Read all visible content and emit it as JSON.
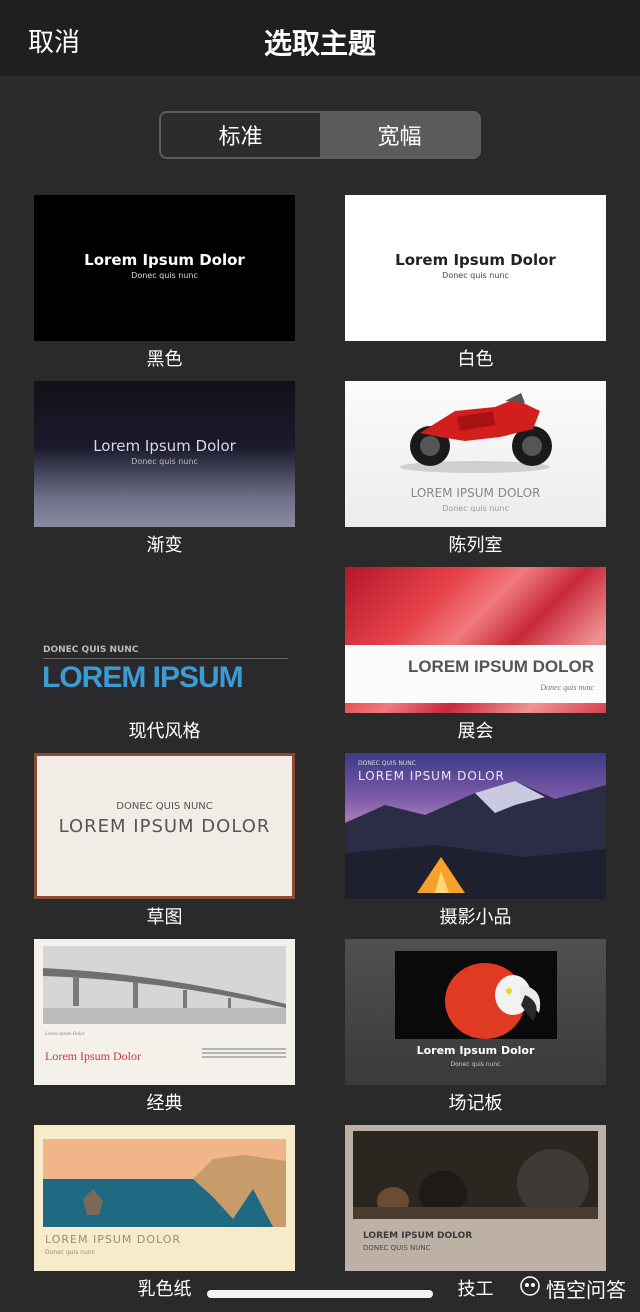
{
  "header": {
    "cancel_label": "取消",
    "title": "选取主题"
  },
  "segments": [
    {
      "label": "标准",
      "selected": true
    },
    {
      "label": "宽幅",
      "selected": false
    }
  ],
  "themes": [
    {
      "name": "黑色",
      "title": "Lorem Ipsum Dolor",
      "subtitle": "Donec quis nunc"
    },
    {
      "name": "白色",
      "title": "Lorem Ipsum Dolor",
      "subtitle": "Donec quis nunc"
    },
    {
      "name": "渐变",
      "title": "Lorem Ipsum Dolor",
      "subtitle": "Donec quis nunc"
    },
    {
      "name": "陈列室",
      "title": "LOREM IPSUM DOLOR",
      "subtitle": "Donec quis nunc"
    },
    {
      "name": "现代风格",
      "title": "LOREM IPSUM",
      "subtitle": "DONEC QUIS NUNC"
    },
    {
      "name": "展会",
      "title": "LOREM IPSUM DOLOR",
      "subtitle": "Donec quis nunc"
    },
    {
      "name": "草图",
      "title": "LOREM IPSUM DOLOR",
      "subtitle": "DONEC QUIS NUNC"
    },
    {
      "name": "摄影小品",
      "title": "LOREM IPSUM DOLOR",
      "subtitle": "DONEC QUIS NUNC"
    },
    {
      "name": "经典",
      "title": "Lorem Ipsum Dolor",
      "subtitle": "Lorem Ipsum Dolor"
    },
    {
      "name": "场记板",
      "title": "Lorem Ipsum Dolor",
      "subtitle": "Donec quis nunc"
    },
    {
      "name": "乳色纸",
      "title": "LOREM IPSUM DOLOR",
      "subtitle": "Donec quis nunc"
    },
    {
      "name": "技工",
      "title": "LOREM IPSUM DOLOR",
      "subtitle": "DONEC QUIS NUNC"
    }
  ],
  "watermark": {
    "text": "悟空问答",
    "icon": "wukong-logo-icon"
  },
  "colors": {
    "background": "#2a2a2b",
    "accent_blue": "#3d9bd4"
  }
}
